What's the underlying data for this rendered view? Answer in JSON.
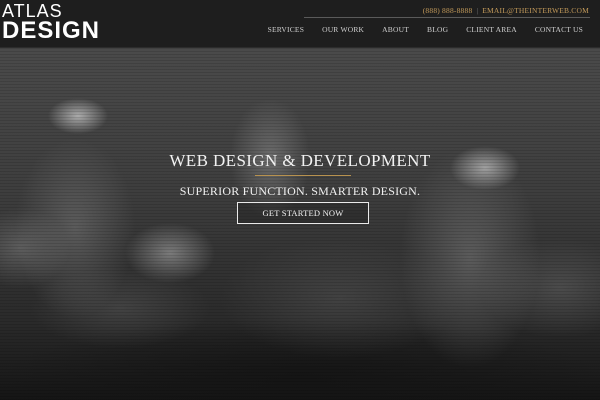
{
  "header": {
    "logo_top": "ATLAS",
    "logo_bottom": "DESIGN",
    "phone": "(888) 888-8888",
    "separator": "|",
    "email": "EMAIL@THEINTERWEB.COM",
    "nav": [
      {
        "label": "SERVICES"
      },
      {
        "label": "OUR WORK"
      },
      {
        "label": "ABOUT"
      },
      {
        "label": "BLOG"
      },
      {
        "label": "CLIENT AREA"
      },
      {
        "label": "CONTACT US"
      }
    ]
  },
  "hero": {
    "title": "WEB DESIGN & DEVELOPMENT",
    "subtitle": "SUPERIOR FUNCTION. SMARTER DESIGN.",
    "cta_label": "GET STARTED NOW"
  },
  "colors": {
    "accent_gold": "#c39a5a",
    "header_bg": "#1e1e1e",
    "text_light": "#f2f2f2"
  }
}
